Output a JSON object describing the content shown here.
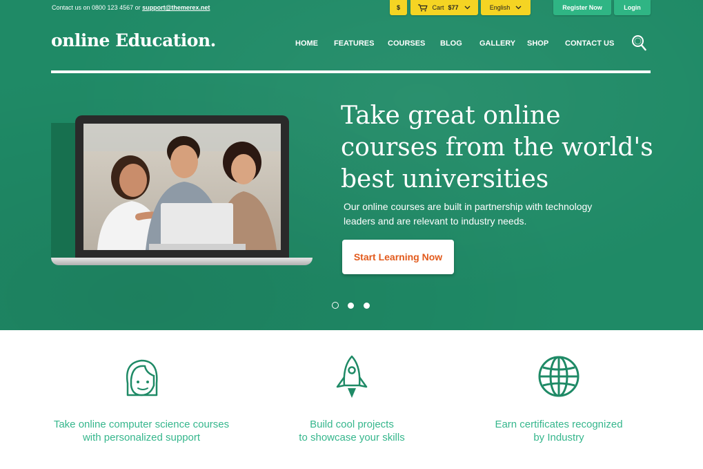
{
  "topbar": {
    "contact_prefix": "Contact us on 0800 123 4567 or",
    "contact_email": "support@themerex.net",
    "currency": "$",
    "cart_label": "Cart",
    "cart_total": "$77",
    "language": "English",
    "register_label": "Register Now",
    "login_label": "Login"
  },
  "logo": "online Education.",
  "nav": {
    "items": [
      "HOME",
      "FEATURES",
      "COURSES",
      "BLOG",
      "GALLERY",
      "SHOP",
      "CONTACT US"
    ]
  },
  "hero": {
    "headline": "Take great online courses from the world's best universities",
    "subtext": "Our online courses are built in partnership with technology leaders and are relevant to industry needs.",
    "cta_label": "Start Learning Now",
    "slides_active_index": 0
  },
  "features": [
    {
      "icon": "person-icon",
      "line1": "Take online computer science courses",
      "line2": "with personalized support"
    },
    {
      "icon": "rocket-icon",
      "line1": "Build cool projects",
      "line2": "to showcase your skills"
    },
    {
      "icon": "globe-icon",
      "line1": "Earn certificates recognized",
      "line2": "by Industry"
    }
  ],
  "colors": {
    "hero_green": "#1f8a66",
    "accent_yellow": "#f5d423",
    "accent_green": "#2fb584",
    "cta_orange": "#e25a1c",
    "feature_text": "#35b68c"
  }
}
